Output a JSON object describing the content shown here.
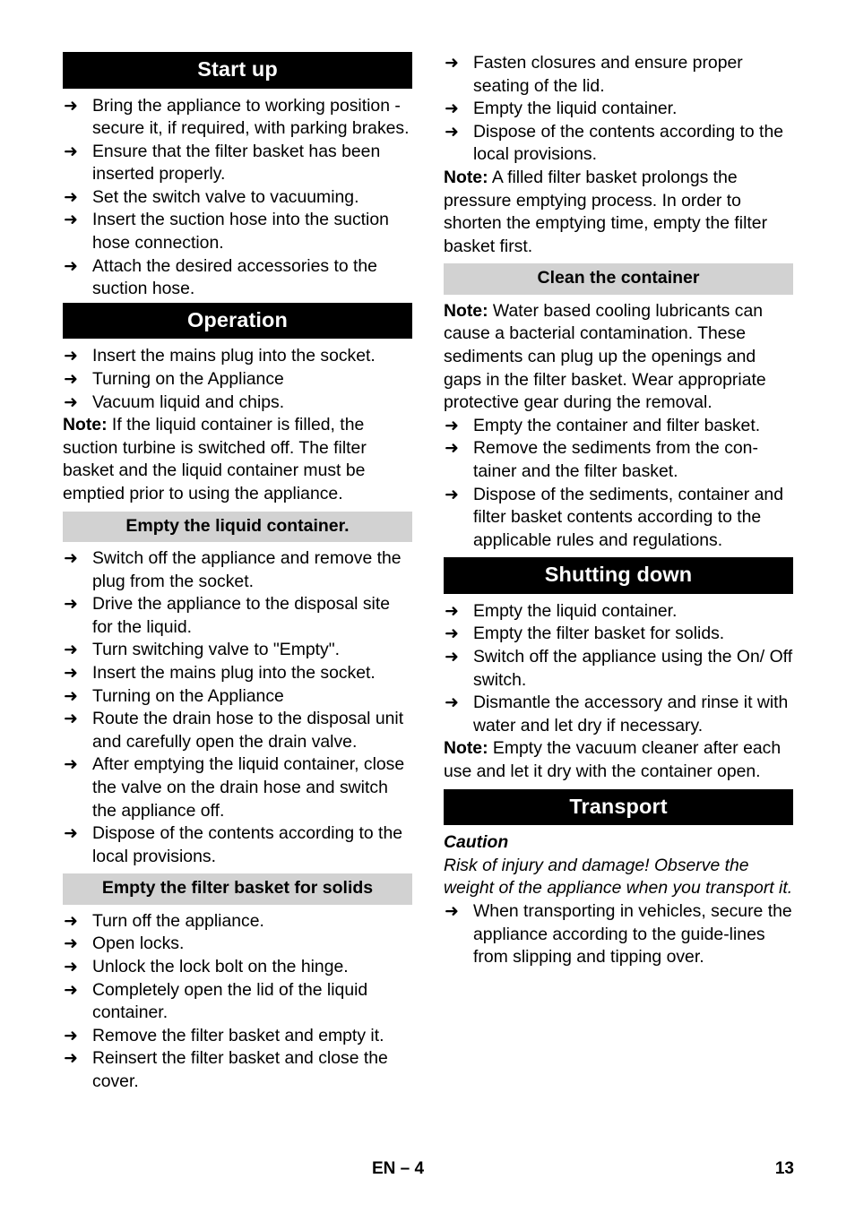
{
  "document": {
    "language_code": "EN",
    "footer_center": "EN – 4",
    "footer_page_number": "13"
  },
  "colors": {
    "heading_black_bg": "#000000",
    "heading_black_text": "#ffffff",
    "heading_gray_bg": "#d2d2d2",
    "heading_gray_text": "#000000",
    "body_text": "#000000",
    "page_bg": "#ffffff"
  },
  "icons": {
    "arrow_bullet": "➜"
  },
  "left_column": {
    "start_up": {
      "heading": "Start up",
      "items": [
        "Bring the appliance to working position - secure it, if required, with parking brakes.",
        "Ensure that the filter basket has been inserted properly.",
        "Set the switch valve to vacuuming.",
        "Insert the suction hose into the suction hose connection.",
        "Attach the desired accessories to the suction hose."
      ]
    },
    "operation": {
      "heading": "Operation",
      "items": [
        "Insert the mains plug into the socket.",
        "Turning on the Appliance",
        "Vacuum liquid and chips."
      ],
      "note_label": "Note:",
      "note_text": " If the liquid container is filled, the suction turbine is switched off. The filter basket and the liquid container must be emptied prior to using the appliance."
    },
    "empty_liquid_container": {
      "heading": "Empty the liquid container.",
      "items": [
        "Switch off the appliance and remove the plug from the socket.",
        "Drive the appliance to the disposal site for the liquid.",
        "Turn switching valve to \"Empty\".",
        "Insert the mains plug into the socket.",
        "Turning on the Appliance",
        "Route the drain hose to the disposal unit and carefully open the drain valve.",
        "After emptying the liquid container, close the valve on the drain hose and switch the appliance off.",
        "Dispose of the contents according to the local provisions."
      ]
    },
    "empty_filter_basket": {
      "heading": "Empty the filter basket for solids",
      "items": [
        "Turn off the appliance.",
        "Open locks.",
        "Unlock the lock bolt on the hinge.",
        "Completely open the lid of the liquid container.",
        "Remove the filter basket and empty it.",
        "Reinsert the filter basket and close the cover."
      ]
    }
  },
  "right_column": {
    "continued_filter_basket": {
      "items": [
        "Fasten closures and ensure proper seating of the lid.",
        "Empty the liquid container.",
        "Dispose of the contents according to the local provisions."
      ],
      "note_label": "Note:",
      "note_text": " A filled filter basket prolongs the pressure emptying process. In order to shorten the emptying time, empty the filter basket first."
    },
    "clean_the_container": {
      "heading": "Clean the container",
      "note_label": "Note:",
      "note_text": " Water based cooling lubricants can cause a bacterial contamination. These sediments can plug up the openings and gaps in the filter basket. Wear appropriate protective gear during the removal.",
      "items": [
        "Empty the container and filter basket.",
        "Remove the sediments from the con-tainer and the filter basket.",
        "Dispose of the sediments, container and filter basket contents according to the applicable rules and regulations."
      ]
    },
    "shutting_down": {
      "heading": "Shutting down",
      "items": [
        "Empty the liquid container.",
        "Empty the filter basket for solids.",
        "Switch off the appliance using the On/ Off switch.",
        "Dismantle the accessory and rinse it with water and let dry if necessary."
      ],
      "note_label": "Note:",
      "note_text": " Empty the vacuum cleaner after each use and let it dry with the container open."
    },
    "transport": {
      "heading": "Transport",
      "caution_title": "Caution",
      "caution_body": "Risk of injury and damage! Observe the weight of the appliance when you transport it.",
      "items": [
        "When transporting in vehicles, secure the appliance according to the guide-lines from slipping and tipping over."
      ]
    }
  }
}
